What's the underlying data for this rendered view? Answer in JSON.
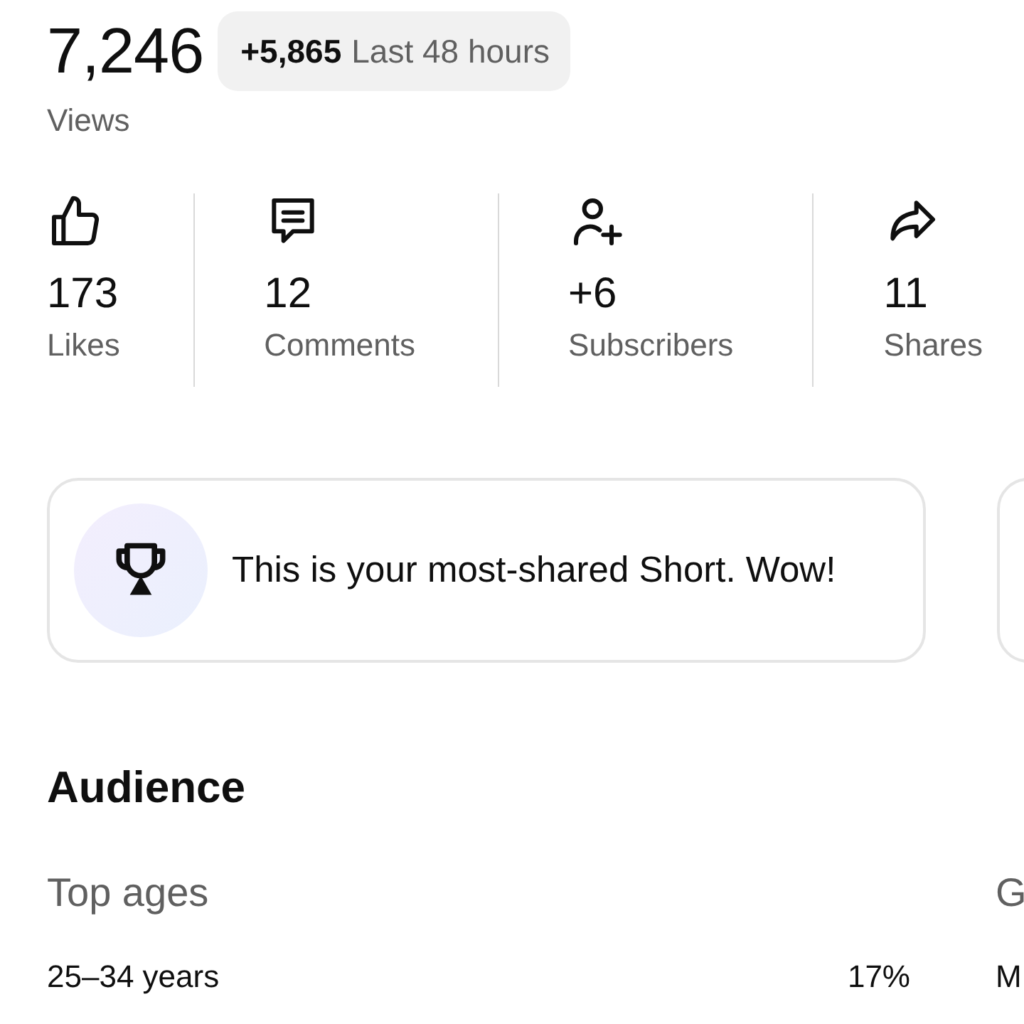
{
  "views": {
    "count": "7,246",
    "label": "Views",
    "change": {
      "delta": "+5,865",
      "period": "Last 48 hours"
    }
  },
  "stats": [
    {
      "kind": "like",
      "value": "173",
      "label": "Likes"
    },
    {
      "kind": "comment",
      "value": "12",
      "label": "Comments"
    },
    {
      "kind": "subscriber",
      "value": "+6",
      "label": "Subscribers"
    },
    {
      "kind": "share",
      "value": "11",
      "label": "Shares"
    }
  ],
  "insight_card": {
    "text": "This is your most-shared Short. Wow!"
  },
  "audience": {
    "title": "Audience",
    "columns": [
      {
        "title": "Top ages",
        "rows": [
          {
            "label": "25–34 years",
            "value": "17%"
          }
        ]
      },
      {
        "title": "G",
        "rows": [
          {
            "label": "M"
          }
        ]
      }
    ]
  }
}
